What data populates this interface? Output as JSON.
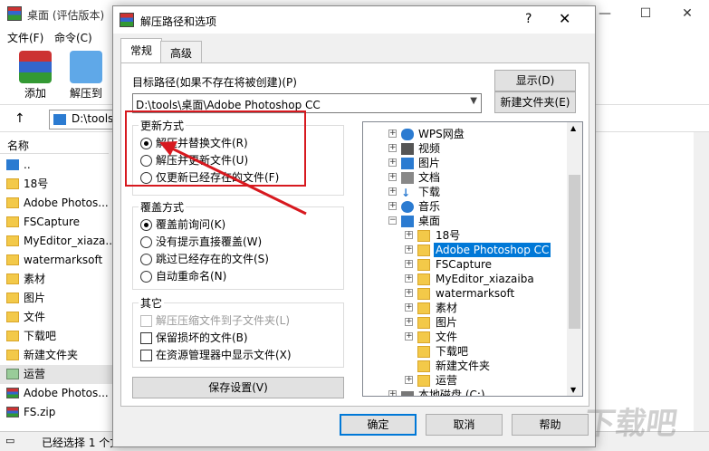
{
  "background_window": {
    "title": "桌面 (评估版本)",
    "menu": [
      "文件(F)",
      "命令(C)"
    ],
    "toolbar": [
      "添加",
      "解压到"
    ],
    "path": "D:\\tools",
    "list_header": "名称",
    "files": [
      "..",
      "18号",
      "Adobe Photos...",
      "FSCapture",
      "MyEditor_xiaza...",
      "watermarksoft",
      "素材",
      "图片",
      "文件",
      "下载吧",
      "新建文件夹",
      "运营",
      "Adobe Photos...",
      "FS.zip"
    ],
    "status": "已经选择 1 个文"
  },
  "dialog": {
    "title": "解压路径和选项",
    "help": "?",
    "close": "✕",
    "tabs": [
      "常规",
      "高级"
    ],
    "dest_label": "目标路径(如果不存在将被创建)(P)",
    "dest_value": "D:\\tools\\桌面\\Adobe Photoshop CC",
    "show_button": "显示(D)",
    "new_folder_button": "新建文件夹(E)",
    "update_group": {
      "title": "更新方式",
      "options": [
        "解压并替换文件(R)",
        "解压并更新文件(U)",
        "仅更新已经存在的文件(F)"
      ]
    },
    "overwrite_group": {
      "title": "覆盖方式",
      "options": [
        "覆盖前询问(K)",
        "没有提示直接覆盖(W)",
        "跳过已经存在的文件(S)",
        "自动重命名(N)"
      ]
    },
    "other_group": {
      "title": "其它",
      "options": [
        "解压压缩文件到子文件夹(L)",
        "保留损坏的文件(B)",
        "在资源管理器中显示文件(X)"
      ]
    },
    "save_button": "保存设置(V)",
    "tree": {
      "items": [
        "WPS网盘",
        "视频",
        "图片",
        "文档",
        "下载",
        "音乐",
        "桌面",
        "18号",
        "Adobe Photoshop CC",
        "FSCapture",
        "MyEditor_xiazaiba",
        "watermarksoft",
        "素材",
        "图片",
        "文件",
        "下载吧",
        "新建文件夹",
        "运营",
        "本地磁盘 (C:)"
      ],
      "selected": "Adobe Photoshop CC"
    },
    "ok_button": "确定",
    "cancel_button": "取消",
    "help_button": "帮助"
  },
  "watermark": "下载吧",
  "colors": {
    "accent": "#0078d7",
    "annotation": "#d7191f"
  }
}
